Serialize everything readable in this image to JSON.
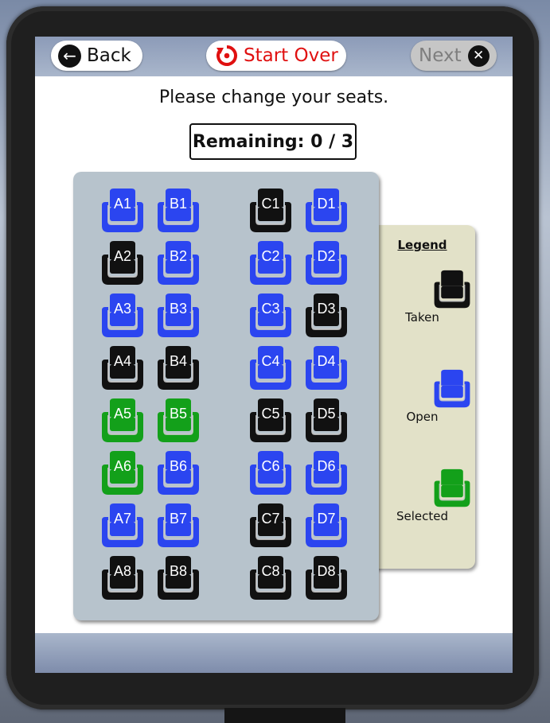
{
  "nav": {
    "back_label": "Back",
    "back_icon": "arrow-left-icon",
    "start_over_label": "Start Over",
    "start_over_icon": "restart-icon",
    "next_label": "Next",
    "next_icon": "close-circle-icon",
    "next_disabled": true
  },
  "prompt": "Please change your seats.",
  "remaining": "Remaining: 0 / 3",
  "colors": {
    "taken": "#111111",
    "open": "#2b45f0",
    "selected": "#13a01a",
    "accent_red": "#e01010"
  },
  "seats": [
    {
      "id": "A1",
      "status": "open"
    },
    {
      "id": "B1",
      "status": "open"
    },
    {
      "id": "C1",
      "status": "taken"
    },
    {
      "id": "D1",
      "status": "open"
    },
    {
      "id": "A2",
      "status": "taken"
    },
    {
      "id": "B2",
      "status": "open"
    },
    {
      "id": "C2",
      "status": "open"
    },
    {
      "id": "D2",
      "status": "open"
    },
    {
      "id": "A3",
      "status": "open"
    },
    {
      "id": "B3",
      "status": "open"
    },
    {
      "id": "C3",
      "status": "open"
    },
    {
      "id": "D3",
      "status": "taken"
    },
    {
      "id": "A4",
      "status": "taken"
    },
    {
      "id": "B4",
      "status": "taken"
    },
    {
      "id": "C4",
      "status": "open"
    },
    {
      "id": "D4",
      "status": "open"
    },
    {
      "id": "A5",
      "status": "selected"
    },
    {
      "id": "B5",
      "status": "selected"
    },
    {
      "id": "C5",
      "status": "taken"
    },
    {
      "id": "D5",
      "status": "taken"
    },
    {
      "id": "A6",
      "status": "selected"
    },
    {
      "id": "B6",
      "status": "open"
    },
    {
      "id": "C6",
      "status": "open"
    },
    {
      "id": "D6",
      "status": "open"
    },
    {
      "id": "A7",
      "status": "open"
    },
    {
      "id": "B7",
      "status": "open"
    },
    {
      "id": "C7",
      "status": "taken"
    },
    {
      "id": "D7",
      "status": "open"
    },
    {
      "id": "A8",
      "status": "taken"
    },
    {
      "id": "B8",
      "status": "taken"
    },
    {
      "id": "C8",
      "status": "taken"
    },
    {
      "id": "D8",
      "status": "taken"
    }
  ],
  "legend": {
    "title": "Legend",
    "items": [
      {
        "label": "Taken",
        "status": "taken"
      },
      {
        "label": "Open",
        "status": "open"
      },
      {
        "label": "Selected",
        "status": "selected"
      }
    ]
  }
}
